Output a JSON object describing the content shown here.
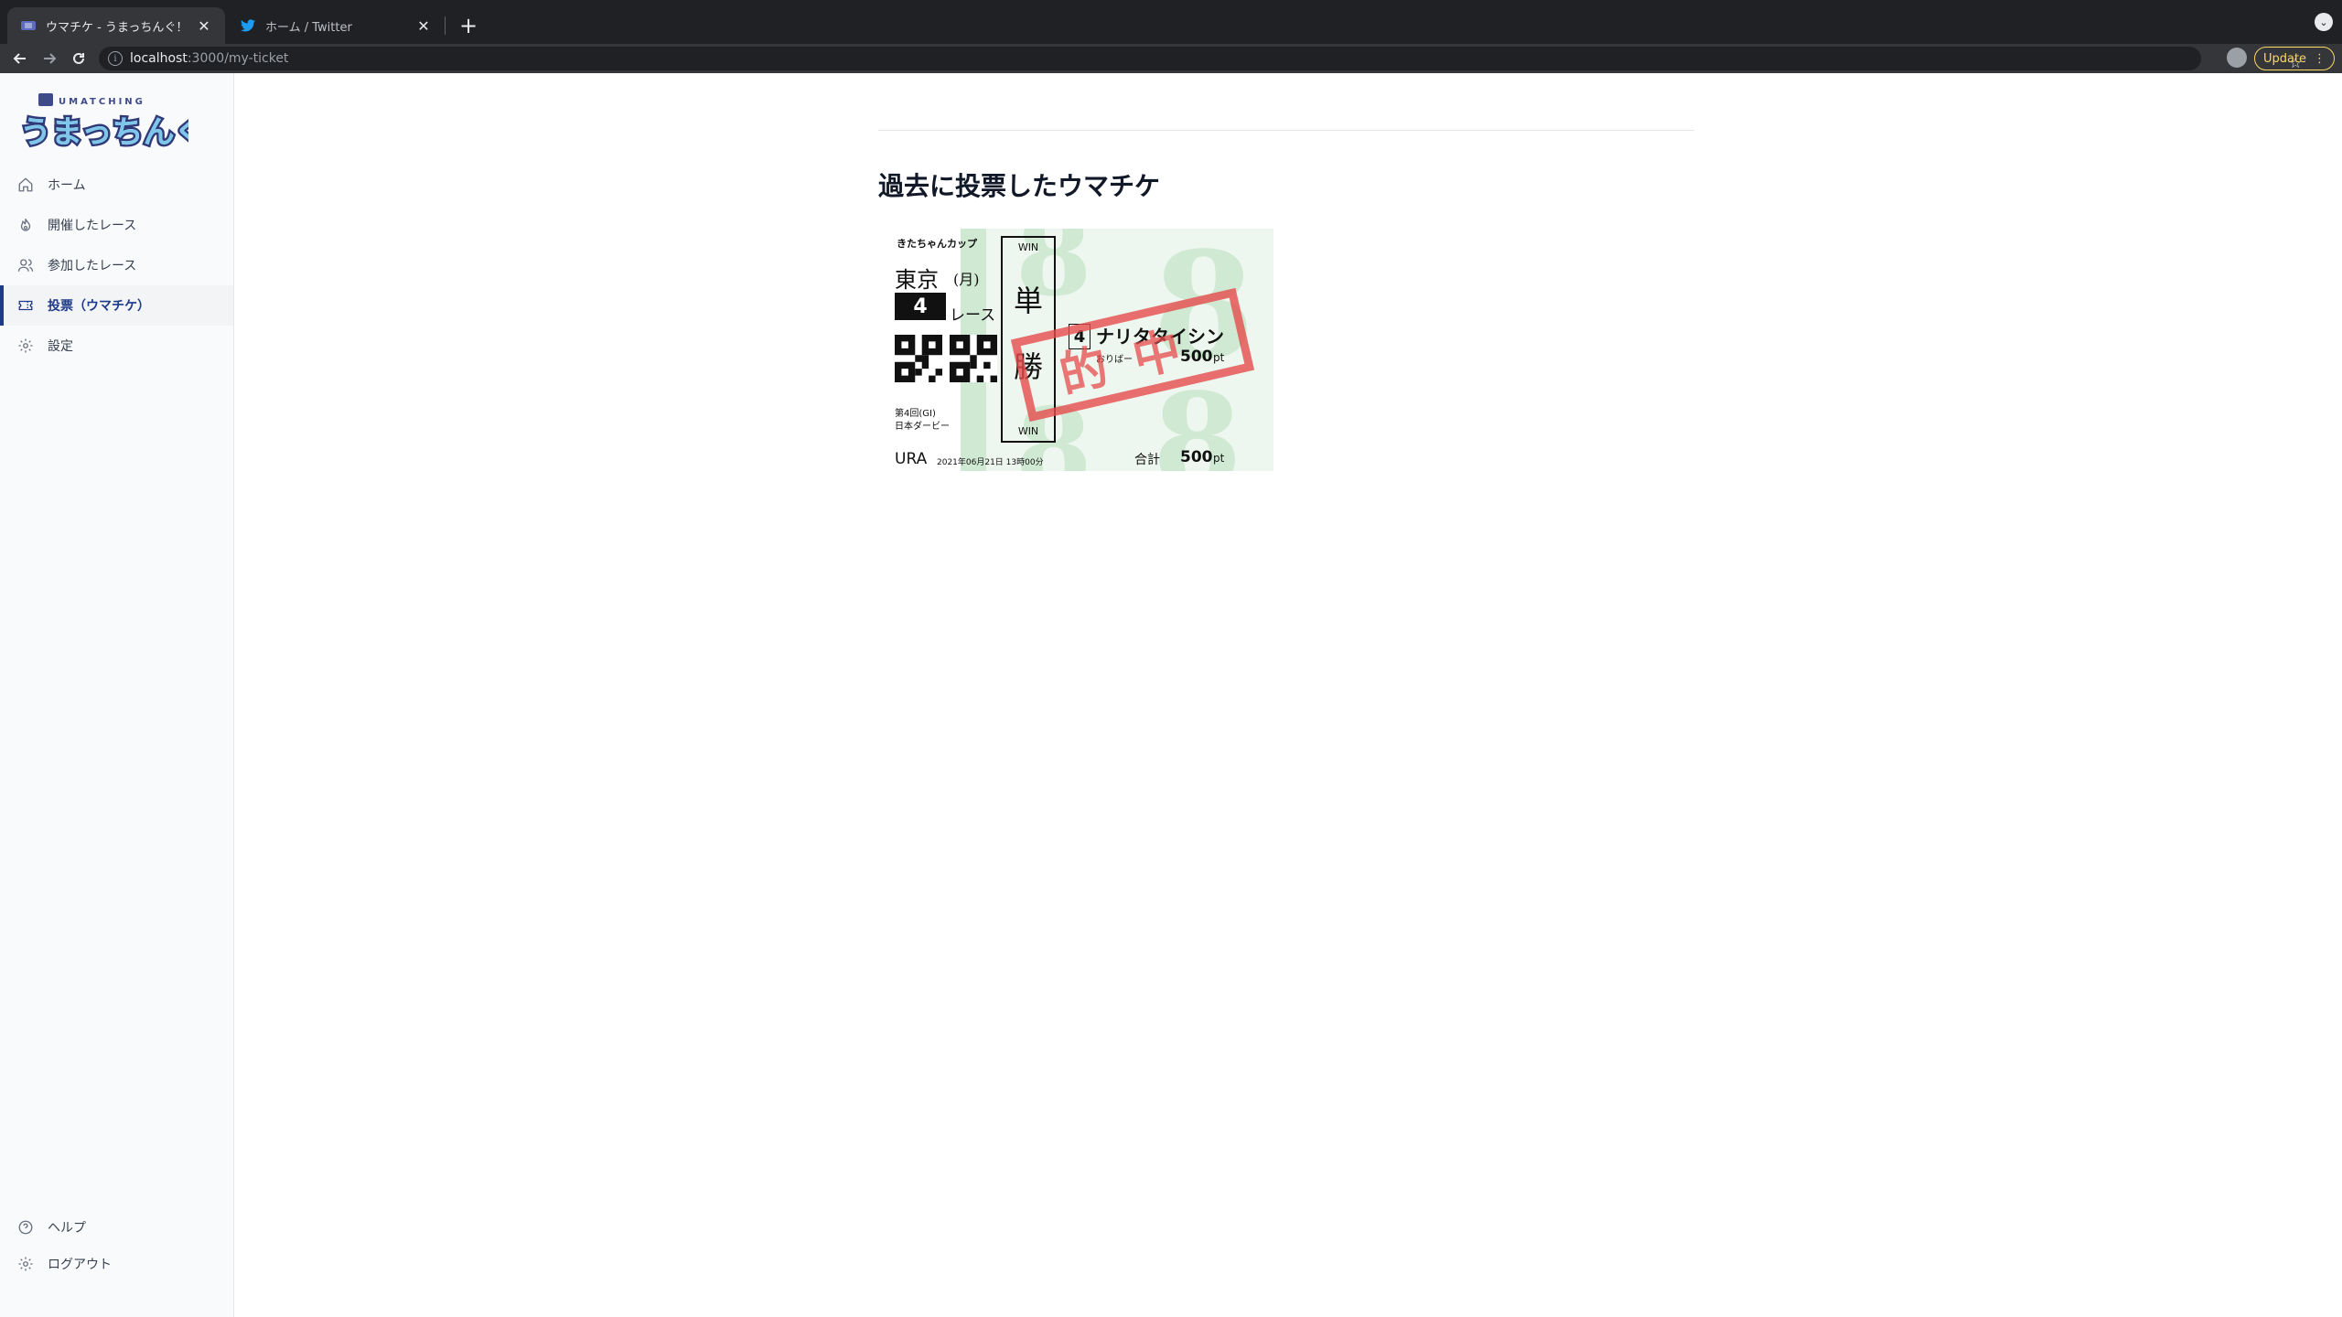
{
  "browser": {
    "tabs": [
      {
        "title": "ウマチケ - うまっちんぐ！"
      },
      {
        "title": "ホーム / Twitter"
      }
    ],
    "url_host": "localhost",
    "url_path": ":3000/my-ticket",
    "update_label": "Update"
  },
  "sidebar": {
    "logo_top": "UMATCHING",
    "logo_main": "うまっちんぐ!",
    "items": [
      {
        "label": "ホーム",
        "icon": "home-icon"
      },
      {
        "label": "開催したレース",
        "icon": "fire-icon"
      },
      {
        "label": "参加したレース",
        "icon": "users-icon"
      },
      {
        "label": "投票（ウマチケ）",
        "icon": "ticket-icon"
      },
      {
        "label": "設定",
        "icon": "gear-icon"
      }
    ],
    "bottom_items": [
      {
        "label": "ヘルプ",
        "icon": "help-icon"
      },
      {
        "label": "ログアウト",
        "icon": "gear-icon"
      }
    ],
    "accent_color": "#1e3a8a"
  },
  "main": {
    "title": "過去に投票したウマチケ"
  },
  "ticket": {
    "cup": "きたちゃんカップ",
    "place": "東京",
    "day": "(月)",
    "race_number": "4",
    "race_label": "レース",
    "round": "第4回(GI)",
    "race_name": "日本ダービー",
    "issuer": "URA",
    "date": "2021年06月21日 13時00分",
    "win_top": "WIN",
    "win_bottom": "WIN",
    "kanji_1": "単",
    "kanji_2": "勝",
    "horse_number": "4",
    "horse_name": "ナリタタイシン",
    "user": "おりばー",
    "amount": "500",
    "unit": "pt",
    "total_label": "合計",
    "total_amount": "500",
    "total_unit": "pt",
    "stamp": "的中",
    "stamp_color": "#e54b4b"
  }
}
